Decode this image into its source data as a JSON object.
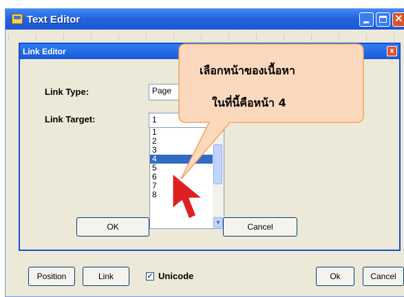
{
  "outer_window": {
    "title": "Text Editor",
    "toolbar": {
      "position_label": "Position",
      "link_label": "Link",
      "unicode_label": "Unicode",
      "unicode_checked": true,
      "checkmark": "✓",
      "ok_label": "Ok",
      "cancel_label": "Cancel"
    }
  },
  "dialog": {
    "title": "Link Editor",
    "close_glyph": "x",
    "link_type_label": "Link Type:",
    "link_type_value": "Page",
    "link_target_label": "Link Target:",
    "link_target_value": "1",
    "target_options": [
      "1",
      "2",
      "3",
      "4",
      "5",
      "6",
      "7",
      "8"
    ],
    "selected_option": "4",
    "ok_label": "OK",
    "cancel_label": "Cancel"
  },
  "callout": {
    "line1": "เลือกหน้าของเนื้อหา",
    "line2": "ในที่นี้คือหน้า 4"
  },
  "colors": {
    "title_bar": "#2663e0",
    "selection": "#316ac5",
    "callout_fill": "#fcd9bd",
    "callout_border": "#f5a063",
    "cursor": "#e02020"
  }
}
